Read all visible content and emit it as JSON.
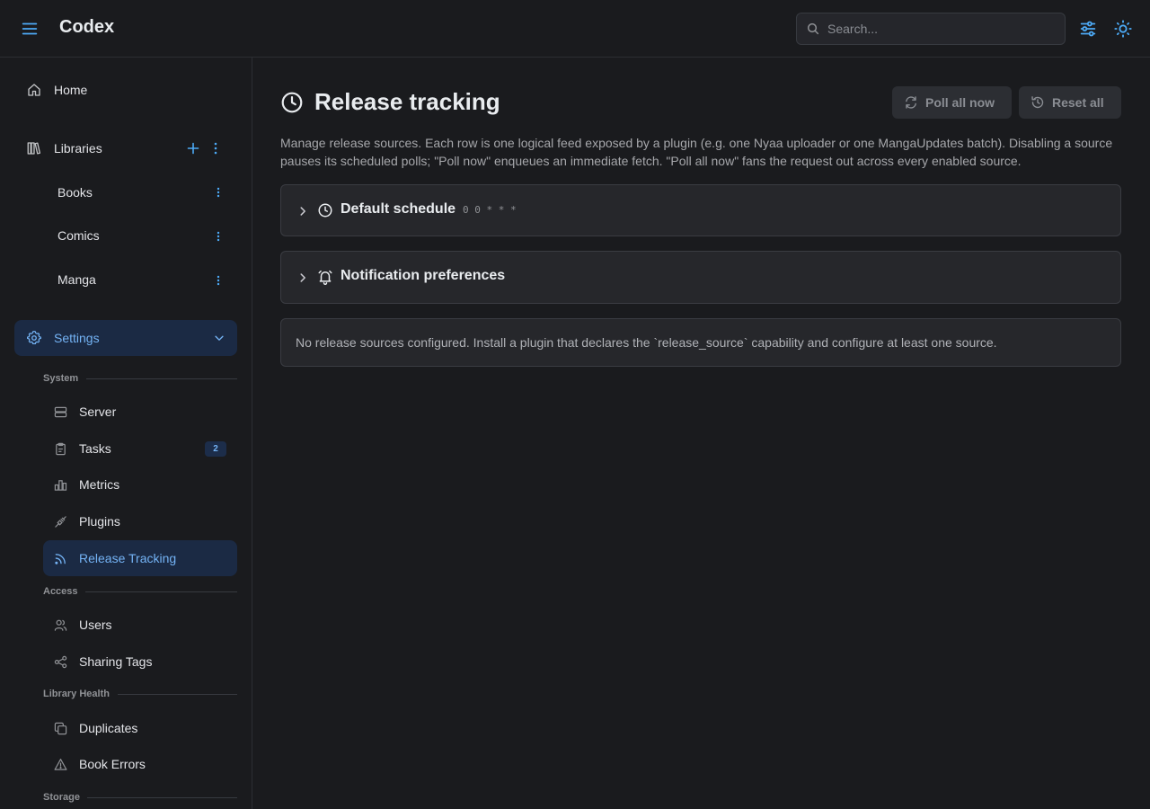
{
  "header": {
    "app_title": "Codex",
    "search_placeholder": "Search...",
    "search_value": ""
  },
  "sidebar": {
    "home_label": "Home",
    "libraries_label": "Libraries",
    "libraries": [
      "Books",
      "Comics",
      "Manga"
    ],
    "settings_label": "Settings",
    "sections": {
      "system": "System",
      "access": "Access",
      "library_health": "Library Health",
      "storage": "Storage"
    },
    "system_items": {
      "server": "Server",
      "tasks": "Tasks",
      "tasks_badge": "2",
      "metrics": "Metrics",
      "plugins": "Plugins",
      "release_tracking": "Release Tracking"
    },
    "access_items": {
      "users": "Users",
      "sharing_tags": "Sharing Tags"
    },
    "health_items": {
      "duplicates": "Duplicates",
      "book_errors": "Book Errors"
    }
  },
  "main": {
    "title": "Release tracking",
    "poll_all_label": "Poll all now",
    "reset_all_label": "Reset all",
    "description": "Manage release sources. Each row is one logical feed exposed by a plugin (e.g. one Nyaa uploader or one MangaUpdates batch). Disabling a source pauses its scheduled polls; \"Poll now\" enqueues an immediate fetch. \"Poll all now\" fans the request out across every enabled source.",
    "default_schedule": {
      "title": "Default schedule",
      "cron": "0 0 * * *"
    },
    "notification_prefs_title": "Notification preferences",
    "empty_message": "No release sources configured. Install a plugin that declares the `release_source` capability and configure at least one source."
  },
  "colors": {
    "accent": "#4dabf7",
    "active_bg": "#1b2a44",
    "background": "#1a1b1e",
    "panel": "#26272b"
  }
}
